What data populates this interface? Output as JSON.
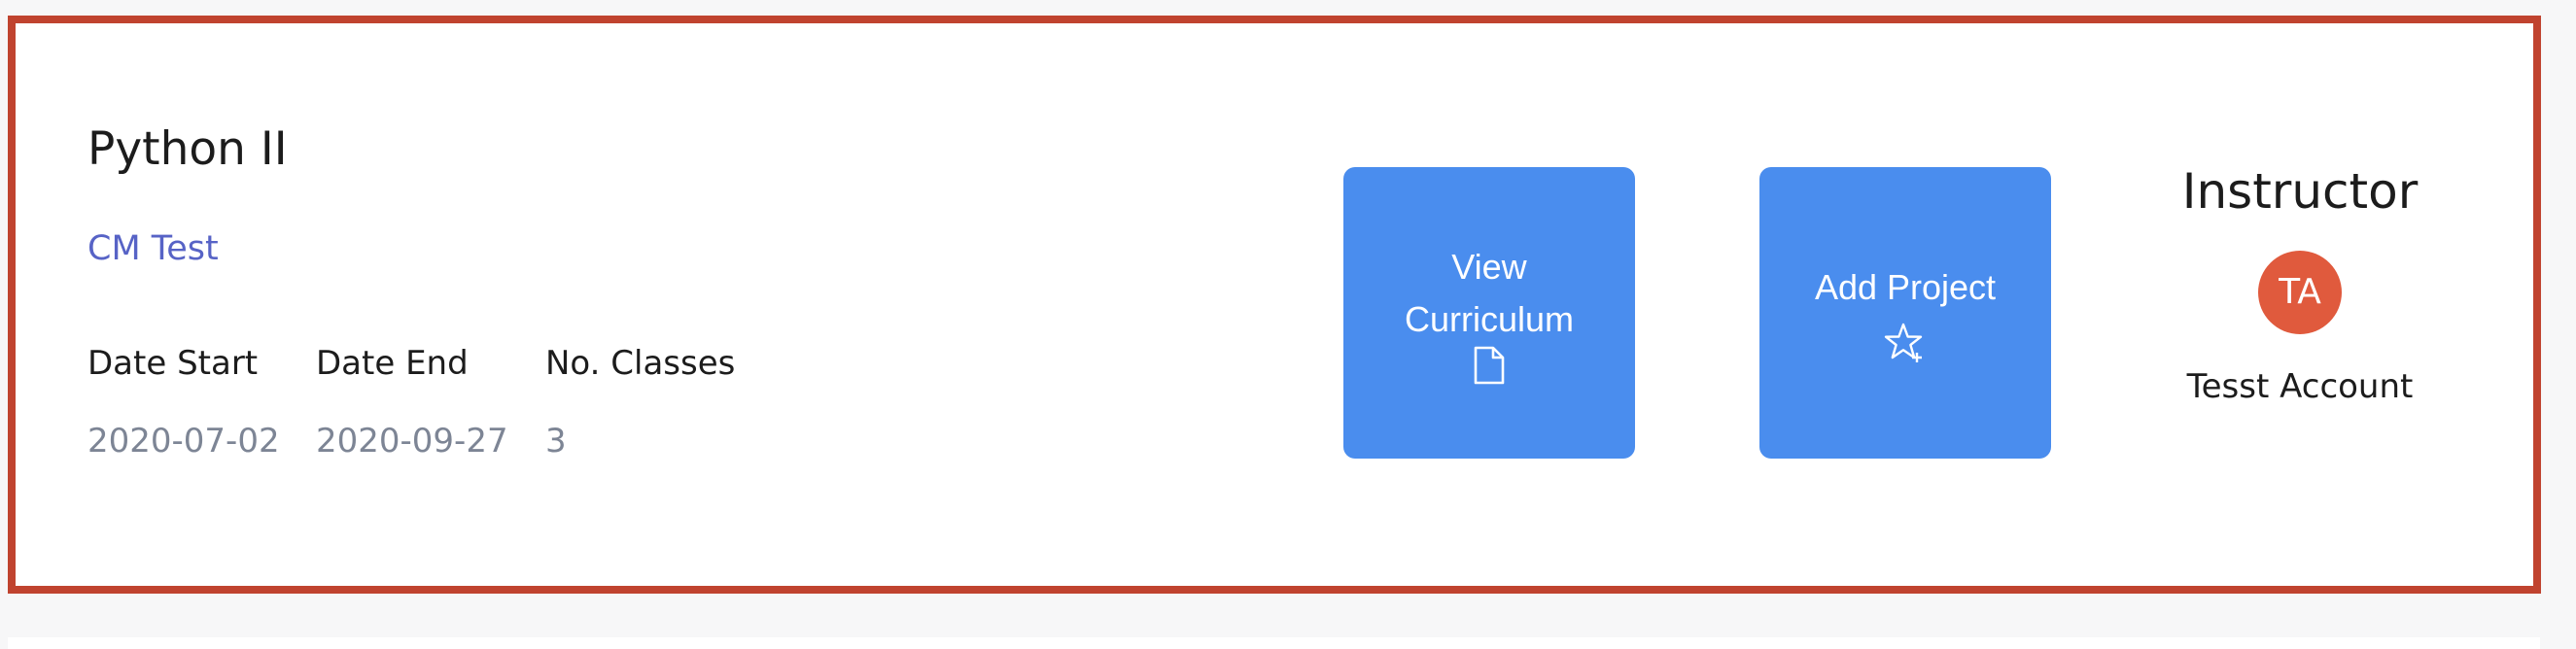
{
  "course": {
    "title": "Python II",
    "subtitle": "CM Test"
  },
  "meta": {
    "date_start_label": "Date Start",
    "date_start_value": "2020-07-02",
    "date_end_label": "Date End",
    "date_end_value": "2020-09-27",
    "classes_label": "No. Classes",
    "classes_value": "3"
  },
  "actions": {
    "view_curriculum_label": "View Curriculum",
    "view_curriculum_icon": "document-icon",
    "add_project_label": "Add Project",
    "add_project_icon": "star-plus-icon"
  },
  "instructor": {
    "heading": "Instructor",
    "initials": "TA",
    "name": "Tesst Account"
  },
  "colors": {
    "card_border": "#c0432f",
    "button_bg": "#4a8dee",
    "link": "#5763c6",
    "avatar_bg": "#e05a3d"
  }
}
